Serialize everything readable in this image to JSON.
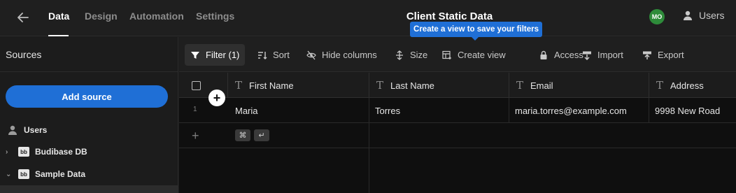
{
  "nav": {
    "tabs": [
      "Data",
      "Design",
      "Automation",
      "Settings"
    ],
    "title": "Client Static Data",
    "avatar_initials": "MO",
    "users_label": "Users"
  },
  "tooltip": "Create a view to save your filters",
  "sidebar": {
    "title": "Sources",
    "add_source": "Add source",
    "items": [
      {
        "label": "Users",
        "icon": "user-icon"
      },
      {
        "label": "Budibase DB",
        "icon": "budibase-icon"
      },
      {
        "label": "Sample Data",
        "icon": "budibase-icon"
      }
    ]
  },
  "toolbar": {
    "filter": "Filter (1)",
    "sort": "Sort",
    "hide_columns": "Hide columns",
    "size": "Size",
    "create_view": "Create view",
    "access": "Access",
    "import": "Import",
    "export": "Export"
  },
  "table": {
    "columns": [
      "First Name",
      "Last Name",
      "Email",
      "Address"
    ],
    "rows": [
      {
        "num": "1",
        "cells": [
          "Maria",
          "Torres",
          "maria.torres@example.com",
          "9998 New Road"
        ]
      }
    ],
    "shortcut_keys": [
      "⌘",
      "↵"
    ]
  },
  "colors": {
    "accent": "#1f6fd6",
    "avatar": "#2e8b3a"
  }
}
